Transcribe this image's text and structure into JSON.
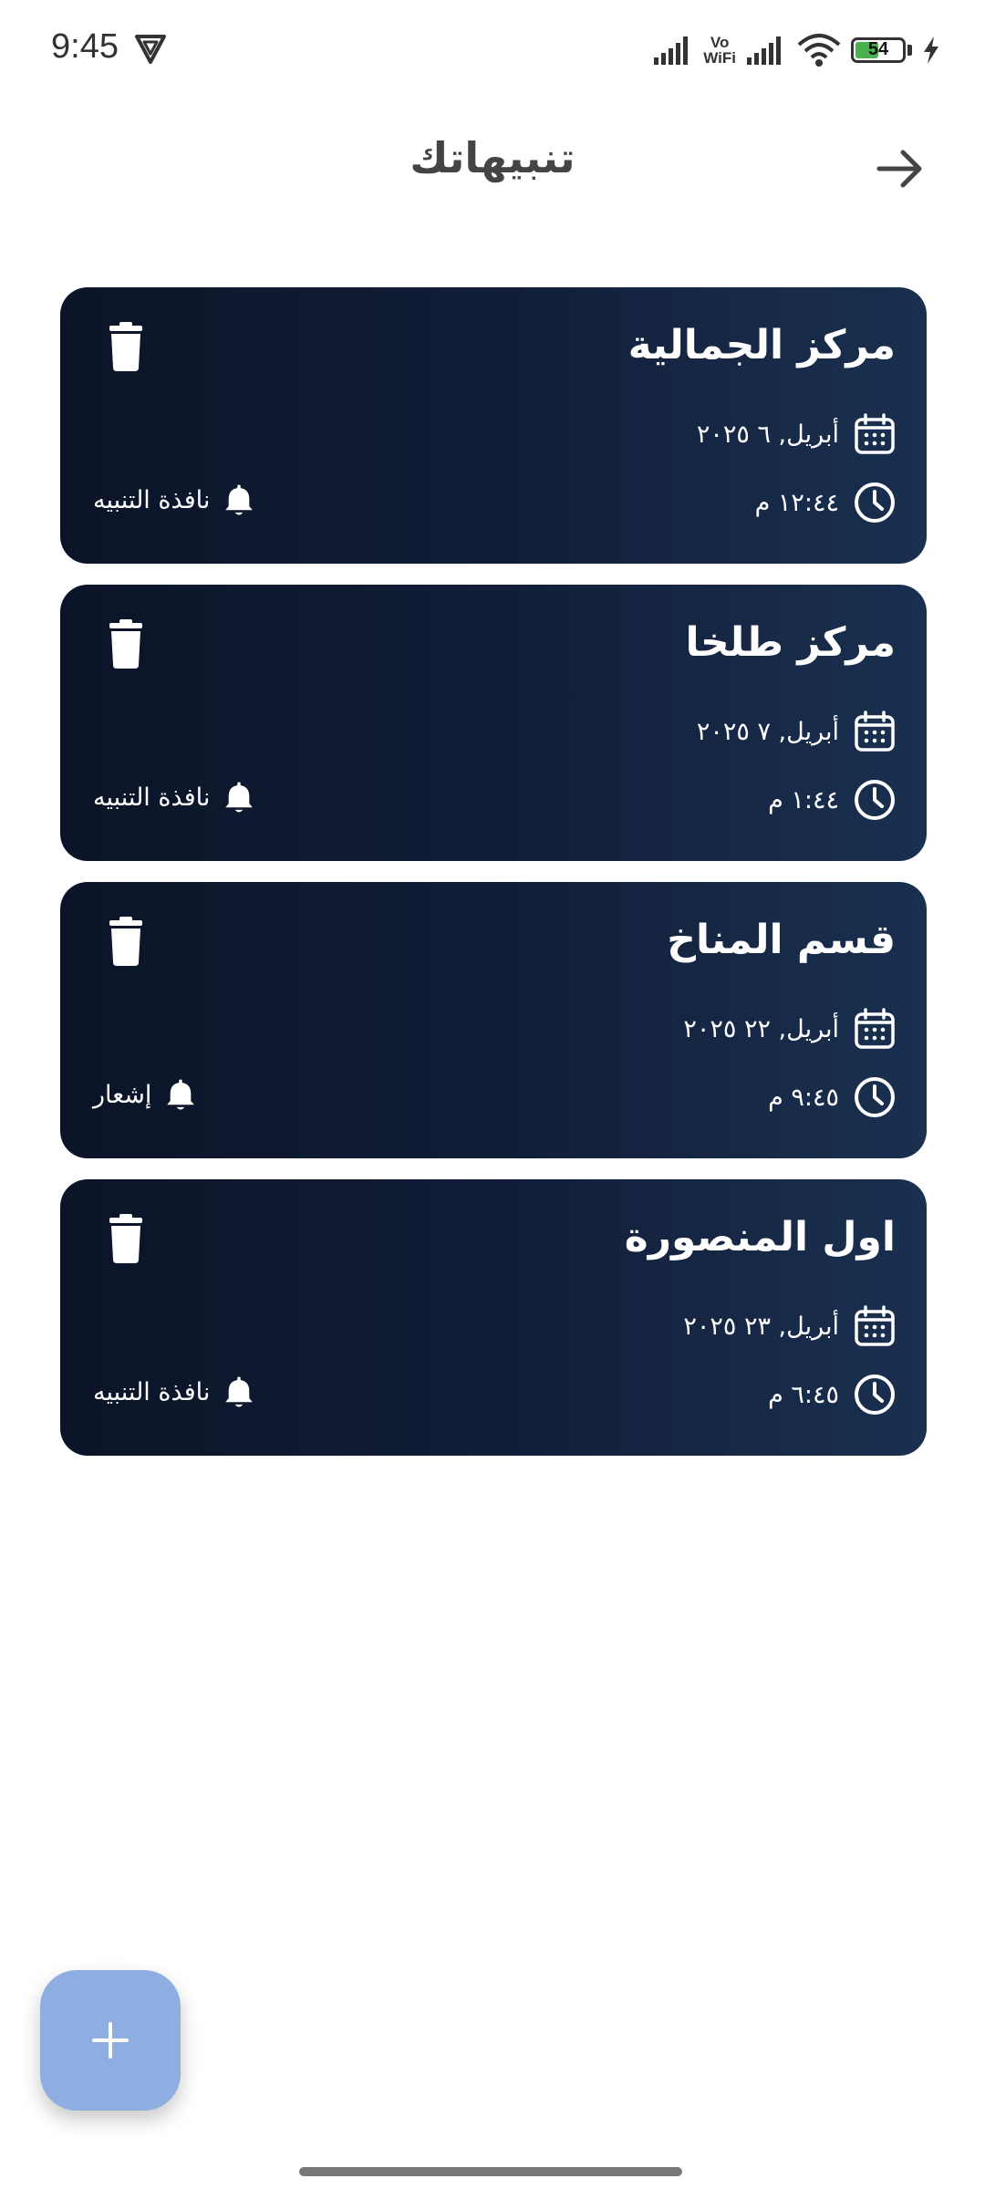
{
  "status_bar": {
    "time": "9:45",
    "vowifi_top": "Vo",
    "vowifi_bottom": "WiFi",
    "battery_level": "54",
    "battery_color": "#4caf50"
  },
  "header": {
    "title": "تنبيهاتك",
    "back_icon": "arrow-right-icon"
  },
  "alerts": [
    {
      "title": "مركز الجمالية",
      "date": "أبريل, ٦ ٢٠٢٥",
      "time": "١٢:٤٤ م",
      "type": "نافذة التنبيه"
    },
    {
      "title": "مركز طلخا",
      "date": "أبريل, ٧ ٢٠٢٥",
      "time": "١:٤٤ م",
      "type": "نافذة التنبيه"
    },
    {
      "title": "قسم المناخ",
      "date": "أبريل, ٢٢ ٢٠٢٥",
      "time": "٩:٤٥ م",
      "type": "إشعار"
    },
    {
      "title": "اول المنصورة",
      "date": "أبريل, ٢٣ ٢٠٢٥",
      "time": "٦:٤٥ م",
      "type": "نافذة التنبيه"
    }
  ],
  "icons": {
    "delete": "trash-icon",
    "date": "calendar-icon",
    "time": "clock-icon",
    "type": "bell-icon",
    "add": "plus-icon"
  },
  "colors": {
    "card_start": "#0b1427",
    "card_end": "#1a3050",
    "fab": "#8eaee2"
  }
}
